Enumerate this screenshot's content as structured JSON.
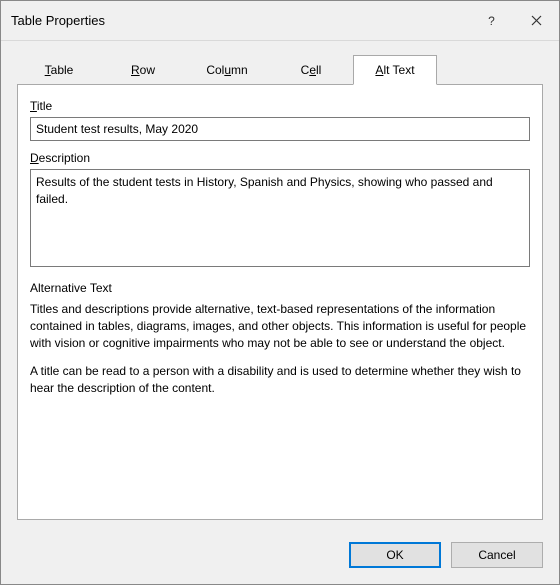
{
  "titlebar": {
    "title": "Table Properties",
    "help_symbol": "?",
    "close_symbol": "✕"
  },
  "tabs": [
    {
      "label": "Table",
      "hotkey_index": 0
    },
    {
      "label": "Row",
      "hotkey_index": 0
    },
    {
      "label": "Column",
      "hotkey_index": 3
    },
    {
      "label": "Cell",
      "hotkey_index": 1
    },
    {
      "label": "Alt Text",
      "hotkey_index": 0
    }
  ],
  "active_tab": 4,
  "fields": {
    "title_label": "Title",
    "title_hotkey_index": 0,
    "title_value": "Student test results, May 2020",
    "description_label": "Description",
    "description_hotkey_index": 0,
    "description_value": "Results of the student tests in History, Spanish and Physics, showing who passed and failed."
  },
  "info": {
    "heading": "Alternative Text",
    "paragraph1": "Titles and descriptions provide alternative, text-based representations of the information contained in tables, diagrams, images, and other objects. This information is useful for people with vision or cognitive impairments who may not be able to see or understand the object.",
    "paragraph2": "A title can be read to a person with a disability and is used to determine whether they wish to hear the description of the content."
  },
  "buttons": {
    "ok": "OK",
    "cancel": "Cancel"
  }
}
